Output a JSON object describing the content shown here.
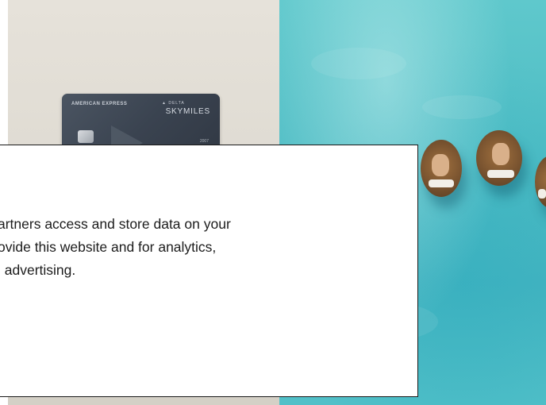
{
  "promo": {
    "card": {
      "issuer": "AMERICAN EXPRESS",
      "partner": "▲ DELTA",
      "product": "SKYMILES",
      "number_fragment": "2007"
    },
    "photo": {
      "subject": "ocean-floats"
    }
  },
  "consent_dialog": {
    "body_text": "artners access and store data on your\novide this website and for analytics,\nl advertising."
  },
  "colors": {
    "dialog_border": "#1a1a1a",
    "ocean": "#4dbcc4",
    "card": "#3a4350"
  }
}
